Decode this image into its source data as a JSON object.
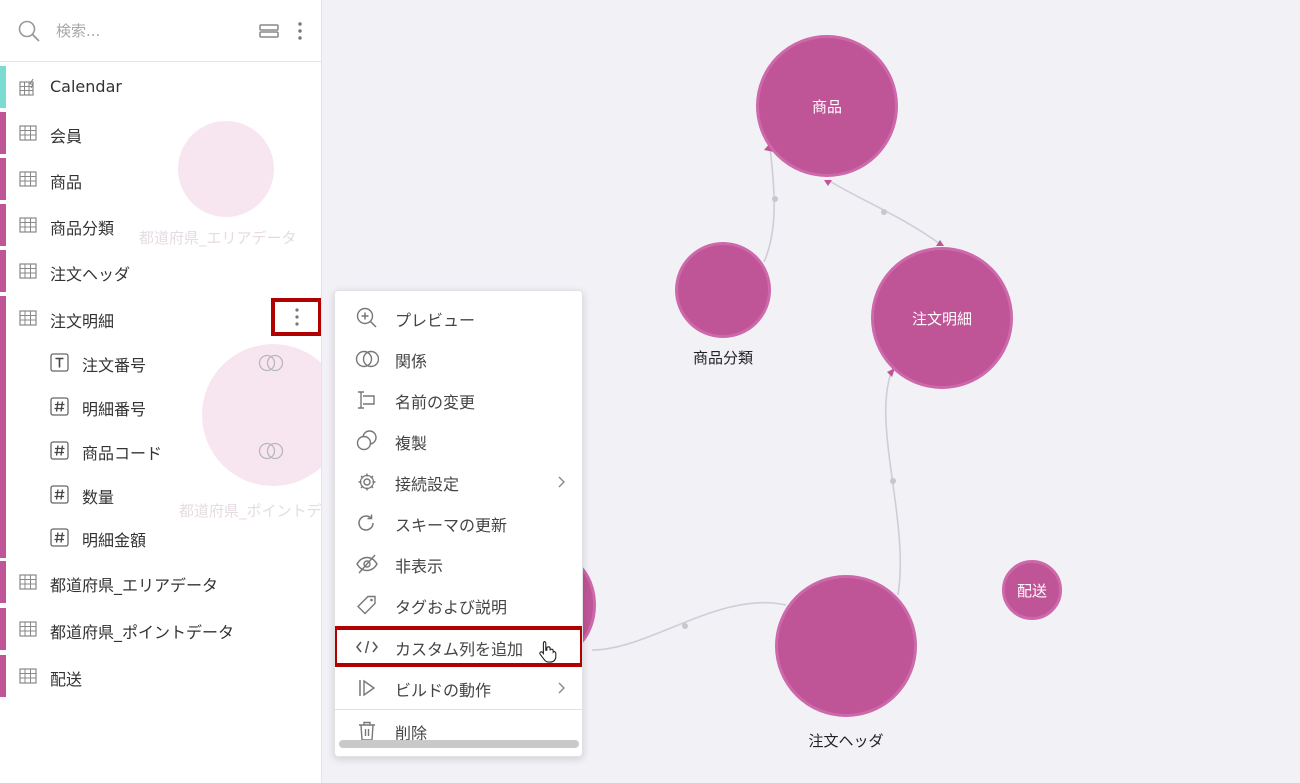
{
  "search": {
    "placeholder": "検索..."
  },
  "tables": [
    {
      "label": "Calendar",
      "accent": "#7ddcd1"
    },
    {
      "label": "会員"
    },
    {
      "label": "商品"
    },
    {
      "label": "商品分類"
    },
    {
      "label": "注文ヘッダ"
    },
    {
      "label": "注文明細"
    },
    {
      "label": "都道府県_エリアデータ"
    },
    {
      "label": "都道府県_ポイントデータ"
    },
    {
      "label": "配送"
    }
  ],
  "columns": [
    {
      "label": "注文番号",
      "type": "text",
      "has_relation": true
    },
    {
      "label": "明細番号",
      "type": "number"
    },
    {
      "label": "商品コード",
      "type": "number",
      "has_relation": true
    },
    {
      "label": "数量",
      "type": "number"
    },
    {
      "label": "明細金額",
      "type": "number"
    }
  ],
  "context_menu": {
    "items": [
      {
        "label": "プレビュー",
        "icon": "zoom-in-icon"
      },
      {
        "label": "関係",
        "icon": "relation-icon"
      },
      {
        "label": "名前の変更",
        "icon": "rename-icon"
      },
      {
        "label": "複製",
        "icon": "duplicate-icon"
      },
      {
        "label": "接続設定",
        "icon": "gear-icon",
        "submenu": true
      },
      {
        "label": "スキーマの更新",
        "icon": "refresh-icon"
      },
      {
        "label": "非表示",
        "icon": "eye-off-icon"
      },
      {
        "label": "タグおよび説明",
        "icon": "tag-icon"
      },
      {
        "label": "カスタム列を追加",
        "icon": "code-icon",
        "highlighted": true
      },
      {
        "label": "ビルドの動作",
        "icon": "play-bar-icon",
        "submenu": true
      },
      {
        "label": "削除",
        "icon": "trash-icon"
      }
    ]
  },
  "graph": {
    "nodes": [
      {
        "label": "商品",
        "label_inside": true
      },
      {
        "label": "商品分類",
        "label_inside": false
      },
      {
        "label": "注文明細",
        "label_inside": true
      },
      {
        "label": "注文ヘッダ",
        "label_inside": false
      },
      {
        "label": "配送",
        "label_inside": true
      }
    ],
    "ghost_labels": [
      "都道府県_エリアデータ",
      "都道府県_ポイントデ"
    ]
  },
  "colors": {
    "node_fill": "#bf5597",
    "table_stripe": "#bf5597",
    "calendar_stripe": "#7ddcd1",
    "highlight_border": "#b00000"
  }
}
